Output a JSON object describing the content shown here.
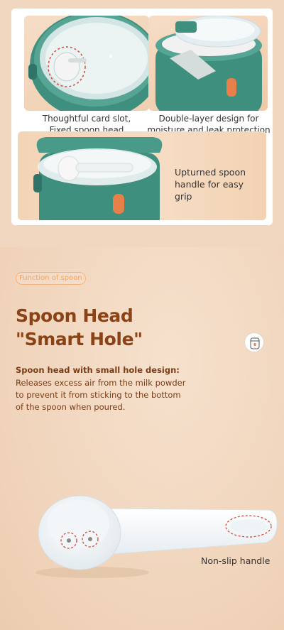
{
  "features": {
    "card_slot_caption": [
      "Thoughtful card slot,",
      "Fixed spoon head"
    ],
    "double_layer_caption": [
      "Double-layer design for",
      "moisture and leak protection"
    ],
    "handle_caption": [
      "Upturned spoon",
      "handle for easy grip"
    ]
  },
  "spoon_section": {
    "badge": "Function of spoon",
    "title_line1": "Spoon Head",
    "title_line2": "\"Smart Hole\"",
    "desc_title": "Spoon head with small hole design:",
    "desc_lines": [
      "Releases excess air from the milk powder",
      "to prevent it from sticking to the bottom",
      "of the spoon when poured."
    ],
    "handle_label": "Non-slip handle"
  },
  "colors": {
    "accent_orange": "#f6a35a",
    "title_brown": "#8a4216",
    "container_green": "#3f8f7f",
    "clasp_orange": "#e8804a"
  }
}
